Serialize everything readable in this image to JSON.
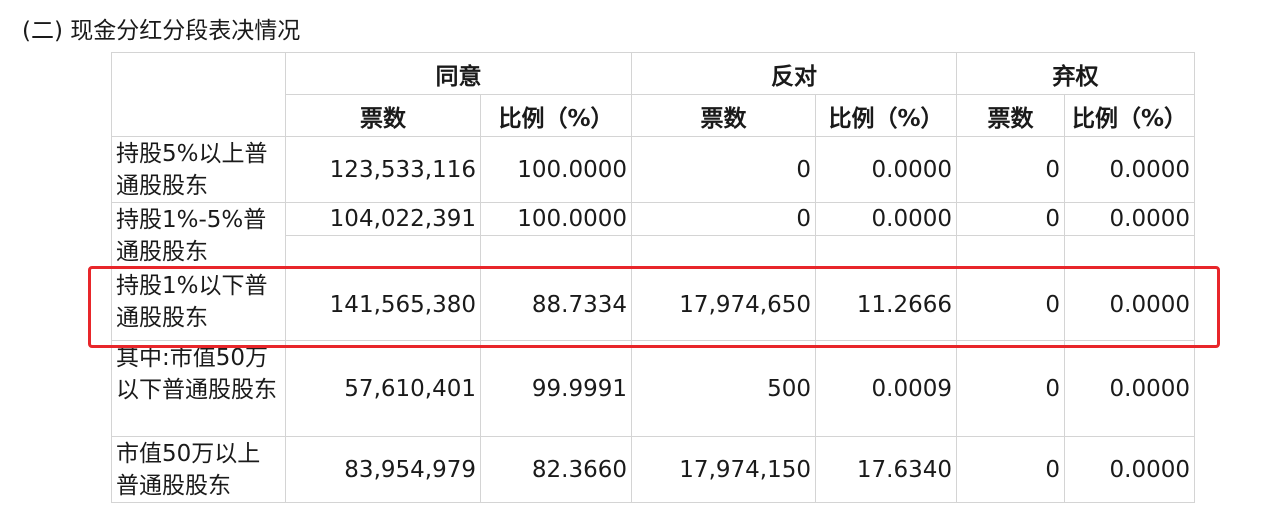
{
  "heading": "(二) 现金分红分段表决情况",
  "groups": [
    "同意",
    "反对",
    "弃权"
  ],
  "subheaders": [
    "票数",
    "比例（%）",
    "票数",
    "比例（%）",
    "票数",
    "比例（%）"
  ],
  "rows": [
    {
      "label": "持股5%以上普通股股东",
      "values": [
        "123,533,116",
        "100.0000",
        "0",
        "0.0000",
        "0",
        "0.0000"
      ]
    },
    {
      "label": "持股1%-5%普通股股东",
      "values": [
        "104,022,391",
        "100.0000",
        "0",
        "0.0000",
        "0",
        "0.0000"
      ]
    },
    {
      "label": "持股1%以下普通股股东",
      "values": [
        "141,565,380",
        "88.7334",
        "17,974,650",
        "11.2666",
        "0",
        "0.0000"
      ]
    },
    {
      "label": "其中:市值50万以下普通股股东",
      "values": [
        "57,610,401",
        "99.9991",
        "500",
        "0.0009",
        "0",
        "0.0000"
      ]
    },
    {
      "label": "市值50万以上普通股股东",
      "values": [
        "83,954,979",
        "82.3660",
        "17,974,150",
        "17.6340",
        "0",
        "0.0000"
      ]
    }
  ],
  "highlight_color": "#e8262a"
}
